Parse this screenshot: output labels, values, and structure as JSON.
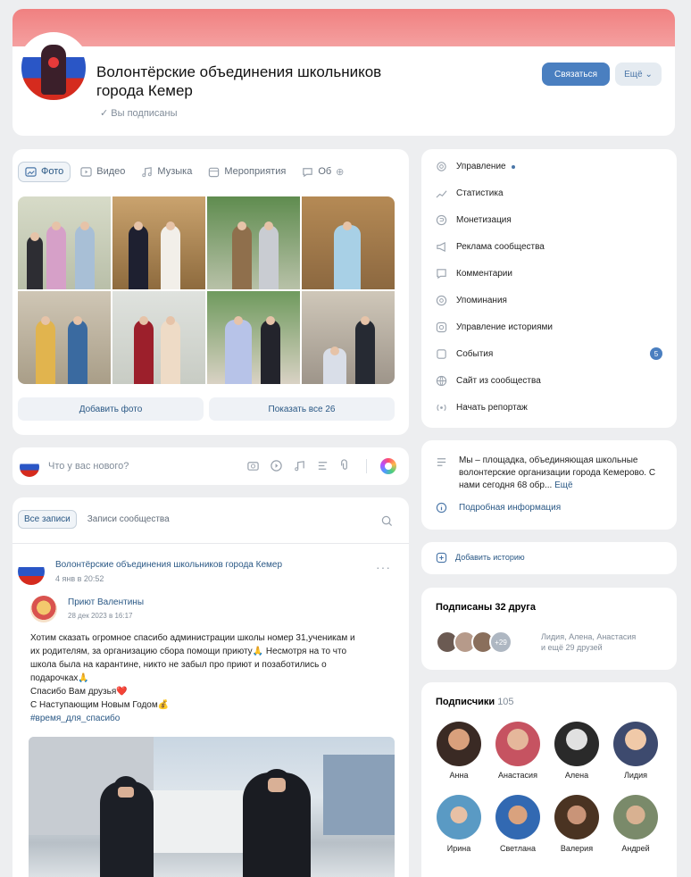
{
  "header": {
    "title_line1": "Волонтёрские объединения школьников",
    "title_line2": "города Кемер",
    "subscribed": "Вы подписаны",
    "contact_btn": "Связаться",
    "more_btn": "Ещё"
  },
  "media_tabs": [
    "Фото",
    "Видео",
    "Музыка",
    "Мероприятия",
    "Об"
  ],
  "media_buttons": {
    "add": "Добавить фото",
    "show_all": "Показать все 26"
  },
  "composer": {
    "placeholder": "Что у вас нового?"
  },
  "feed": {
    "tab_all": "Все записи",
    "tab_community": "Записи сообщества",
    "post": {
      "author": "Волонтёрские объединения школьников города Кемер",
      "date": "4 янв в 20:52",
      "repost_author": "Приют Валентины",
      "repost_date": "28 дек 2023 в 16:17",
      "text_line1": "Хотим сказать огромное спасибо администрации школы номер 31,ученикам и",
      "text_line2": "их родителям, за организацию сбора помощи приюту🙏 Несмотря на то что",
      "text_line3": "школа была на карантине, никто не забыл про приют и позаботились о",
      "text_line4": "подарочках🙏",
      "text_line5": "Спасибо Вам друзья❤️",
      "text_line6": "С Наступающим Новым Годом💰",
      "hashtag": "#время_для_спасибо"
    }
  },
  "menu": [
    "Управление",
    "Статистика",
    "Монетизация",
    "Реклама сообщества",
    "Комментарии",
    "Упоминания",
    "Управление историями",
    "События",
    "Сайт из сообщества",
    "Начать репортаж"
  ],
  "events_badge": "5",
  "about": {
    "text": "Мы – площадка, объединяющая школьные волонтерские организации города Кемерово. С нами сегодня 68 обр...",
    "more": "Ещё",
    "info": "Подробная информация"
  },
  "story": "Добавить историю",
  "friends": {
    "title": "Подписаны 32 друга",
    "count_badge": "+29",
    "names_line1": "Лидия, Алена, Анастасия",
    "names_line2": "и ещё 29 друзей"
  },
  "subscribers": {
    "title": "Подписчики",
    "count": "105",
    "people": [
      "Анна",
      "Анастасия",
      "Алена",
      "Лидия",
      "Ирина",
      "Светлана",
      "Валерия",
      "Андрей"
    ]
  }
}
